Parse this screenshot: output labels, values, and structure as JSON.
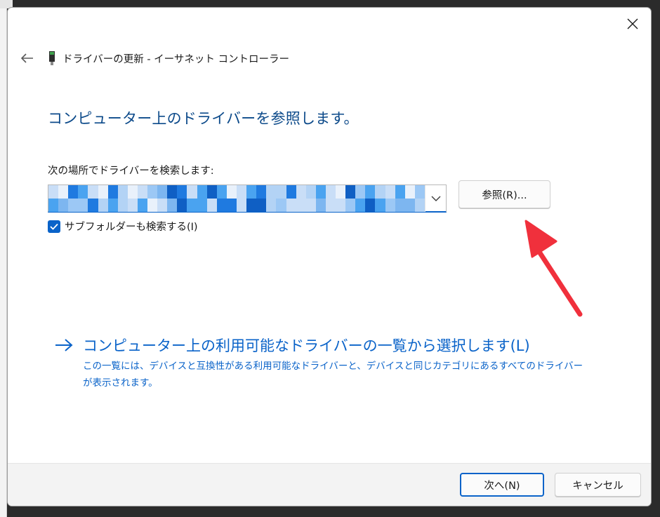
{
  "window": {
    "title": "ドライバーの更新 - イーサネット コントローラー",
    "close_icon": "close-icon",
    "back_icon": "arrow-left-icon",
    "device_icon": "network-adapter-icon"
  },
  "main": {
    "heading": "コンピューター上のドライバーを参照します。",
    "search_label": "次の場所でドライバーを検索します:",
    "path_combo": {
      "value_redacted": true,
      "dropdown_icon": "chevron-down-icon"
    },
    "browse_label": "参照(R)...",
    "include_subfolders": {
      "label": "サブフォルダーも検索する(I)",
      "checked": true
    },
    "pick_link": {
      "icon": "arrow-right-icon",
      "label": "コンピューター上の利用可能なドライバーの一覧から選択します(L)",
      "description": "この一覧には、デバイスと互換性がある利用可能なドライバーと、デバイスと同じカテゴリにあるすべてのドライバーが表示されます。"
    },
    "annotation": {
      "icon": "red-arrow-icon",
      "color": "#f0303c"
    }
  },
  "footer": {
    "next_label": "次へ(N)",
    "cancel_label": "キャンセル"
  },
  "colors": {
    "accent": "#0a63c9",
    "heading": "#0c4a8a",
    "footer_bg": "#f3f3f3",
    "backdrop": "#2b2b2b"
  }
}
